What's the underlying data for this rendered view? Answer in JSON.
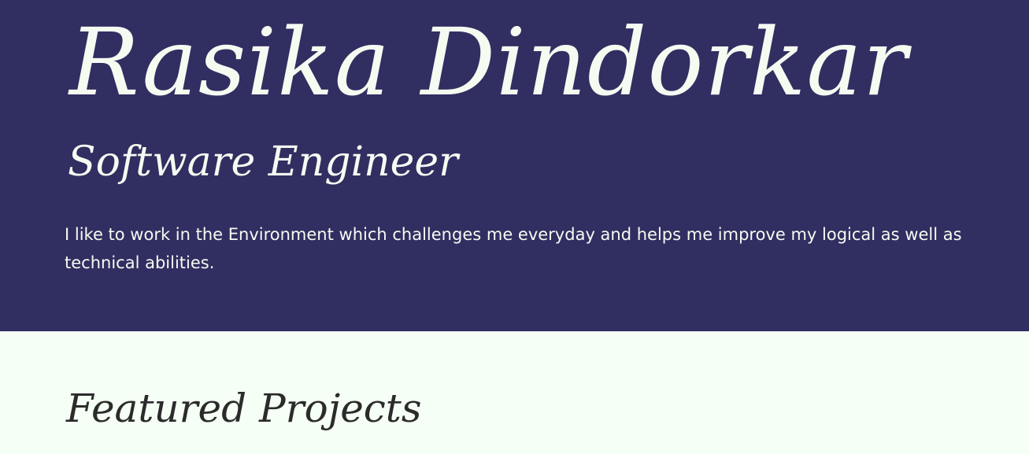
{
  "hero": {
    "name": "Rasika Dindorkar",
    "role": "Software Engineer",
    "bio": "I like to work in the Environment which challenges me everyday and helps me improve my logical as well as technical abilities."
  },
  "projects": {
    "title": "Featured Projects"
  },
  "colors": {
    "hero_background": "#312e61",
    "hero_text": "#f6fbf2",
    "page_background": "#f5fff5",
    "heading_text": "#2b2b2b"
  }
}
